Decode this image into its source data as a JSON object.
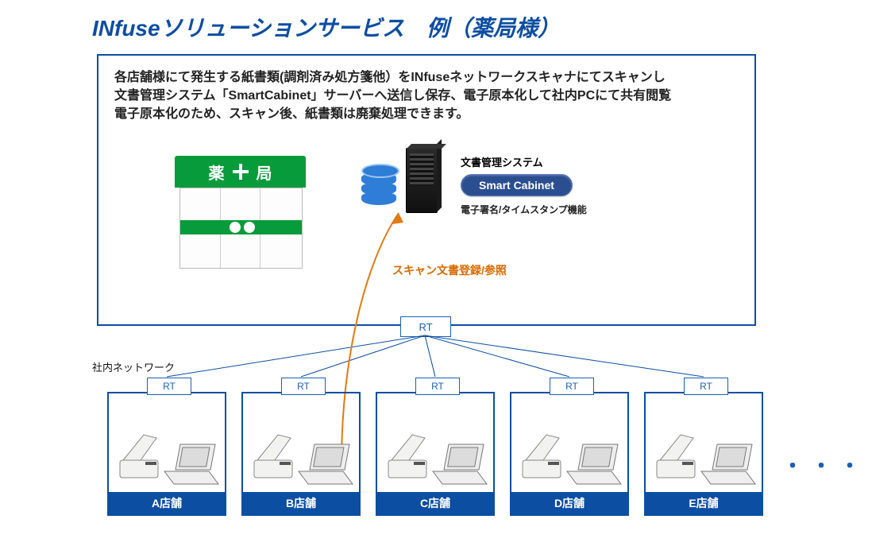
{
  "title": "INfuseソリューションサービス　例（薬局様）",
  "description_line1": "各店舗様にて発生する紙書類(調剤済み処方箋他）をINfuseネットワークスキャナにてスキャンし",
  "description_line2": "文書管理システム「SmartCabinet」サーバーへ送信し保存、電子原本化して社内PCにて共有閲覧",
  "description_line3": "電子原本化のため、スキャン後、紙書類は廃棄処理できます。",
  "pharmacy_sign": {
    "left": "薬",
    "right": "局"
  },
  "system": {
    "label": "文書管理システム",
    "product": "Smart Cabinet",
    "sub": "電子署名/タイムスタンプ機能"
  },
  "scan_flow_label": "スキャン文書登録/参照",
  "central_router": "RT",
  "network_label": "社内ネットワーク",
  "store_router": "RT",
  "stores": {
    "a": "A店舗",
    "b": "B店舗",
    "c": "C店舗",
    "d": "D店舗",
    "e": "E店舗"
  },
  "ellipsis": "・・・"
}
